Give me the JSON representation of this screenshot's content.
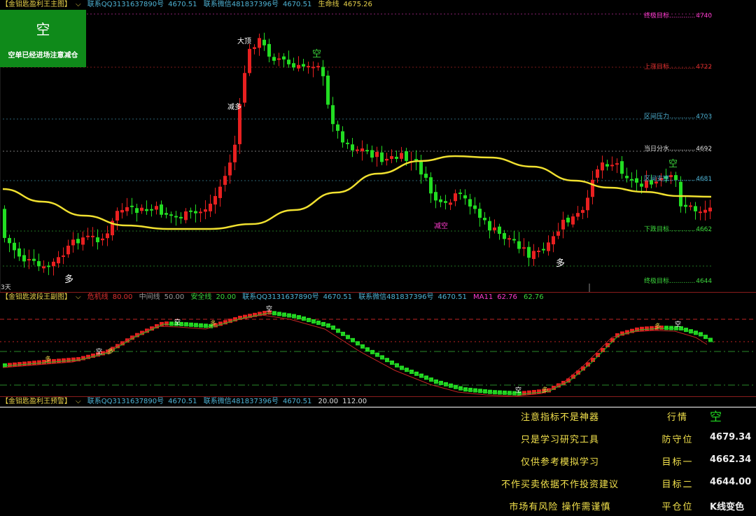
{
  "main": {
    "header": [
      "【金钼匙盈利王主图】",
      "联系QQ3131637890号",
      "4670.51",
      "联系微信481837396号",
      "4670.51",
      "生命线",
      "4675.26"
    ],
    "signal_box": {
      "title": "空",
      "text": "空单已经进场注意减仓",
      "color": "#0f8a1a"
    },
    "left_label": "3天",
    "annotations": [
      "大顶",
      "减多",
      "空",
      "减空",
      "多",
      "多",
      "空"
    ],
    "targets": [
      {
        "label": "终极目标",
        "value": "4740",
        "color": "#ff3ccf"
      },
      {
        "label": "上涨目标",
        "value": "4722",
        "color": "#e03030"
      },
      {
        "label": "区间压力",
        "value": "4703",
        "color": "#4fb4d6"
      },
      {
        "label": "当日分水",
        "value": "4692",
        "color": "#dddddd"
      },
      {
        "label": "区间支撑",
        "value": "4681",
        "color": "#4fb4d6"
      },
      {
        "label": "下跌目标",
        "value": "4662",
        "color": "#3cd63c"
      },
      {
        "label": "终极目标",
        "value": "4644",
        "color": "#3cd63c"
      }
    ]
  },
  "sub": {
    "header": [
      "【金钼匙波段王副图】",
      "危机线",
      "80.00",
      "中间线",
      "50.00",
      "安全线",
      "20.00",
      "联系QQ3131637890号",
      "4670.51",
      "联系微信481837396号",
      "4670.51",
      "MA11",
      "62.76",
      "62.76"
    ],
    "annotations": [
      "多",
      "空",
      "多",
      "空",
      "多",
      "空",
      "多",
      "空",
      "多",
      "空"
    ]
  },
  "alert": {
    "header": [
      "【金钼匙盈利王预警】",
      "联系QQ3131637890号",
      "4670.51",
      "联系微信481837396号",
      "4670.51",
      "20.00",
      "112.00"
    ],
    "rows": [
      {
        "msg": "注意指标不是神器",
        "key": "行情",
        "val": "空"
      },
      {
        "msg": "只是学习研究工具",
        "key": "防守位",
        "val": "4679.34"
      },
      {
        "msg": "仅供参考模拟学习",
        "key": "目标一",
        "val": "4662.34"
      },
      {
        "msg": "不作买卖依据不作投资建议",
        "key": "目标二",
        "val": "4644.00"
      },
      {
        "msg": "市场有风险 操作需谨慎",
        "key": "平仓位",
        "val": "K线变色"
      }
    ]
  },
  "colors": {
    "up": "#e82020",
    "down": "#22dd22",
    "lifeline": "#f0e030",
    "accent_green": "#0f8a1a"
  },
  "chart_data": {
    "type": "candlestick",
    "price_range": [
      4640,
      4745
    ],
    "series": [
      {
        "name": "生命线",
        "last": 4675.26
      }
    ],
    "oscillator": {
      "levels": {
        "危机线": 80,
        "中间线": 50,
        "安全线": 20
      },
      "ma11": 62.76
    }
  }
}
